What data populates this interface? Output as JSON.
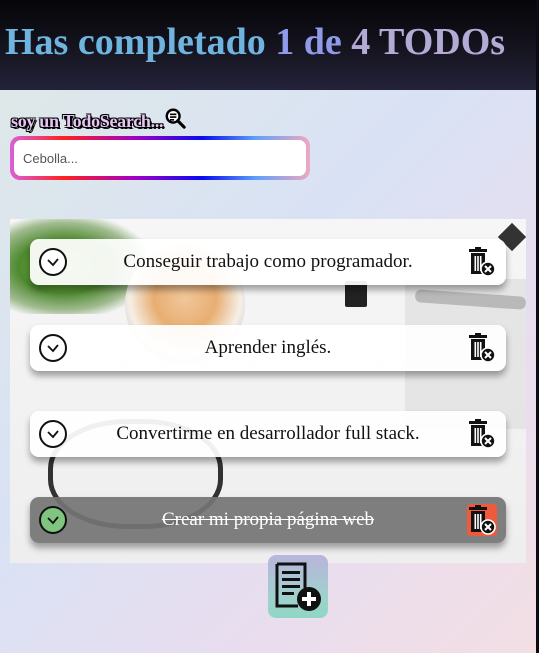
{
  "header": {
    "title_start": "Has completado",
    "completed": "1",
    "title_mid": "de",
    "total": "4",
    "title_end": "TODOs"
  },
  "search": {
    "label": "soy un TodoSearch...",
    "placeholder": "Cebolla...",
    "value": ""
  },
  "todos": [
    {
      "text": "Conseguir trabajo como programador.",
      "completed": false
    },
    {
      "text": "Aprender inglés.",
      "completed": false
    },
    {
      "text": "Convertirme en desarrollador full stack.",
      "completed": false
    },
    {
      "text": "Crear mi propia página web",
      "completed": true
    }
  ],
  "icons": {
    "search": "magnifier-icon",
    "check": "check-icon",
    "delete": "trash-delete-icon",
    "create": "add-note-icon"
  },
  "colors": {
    "header_bg": "#15141f",
    "title_gradient_start": "#6fb4de",
    "title_gradient_end": "#b3aad6",
    "done_bg": "#747474",
    "done_check": "#7fc47f",
    "done_delete": "#f05a3c",
    "create_button": "#9fd2cc"
  }
}
